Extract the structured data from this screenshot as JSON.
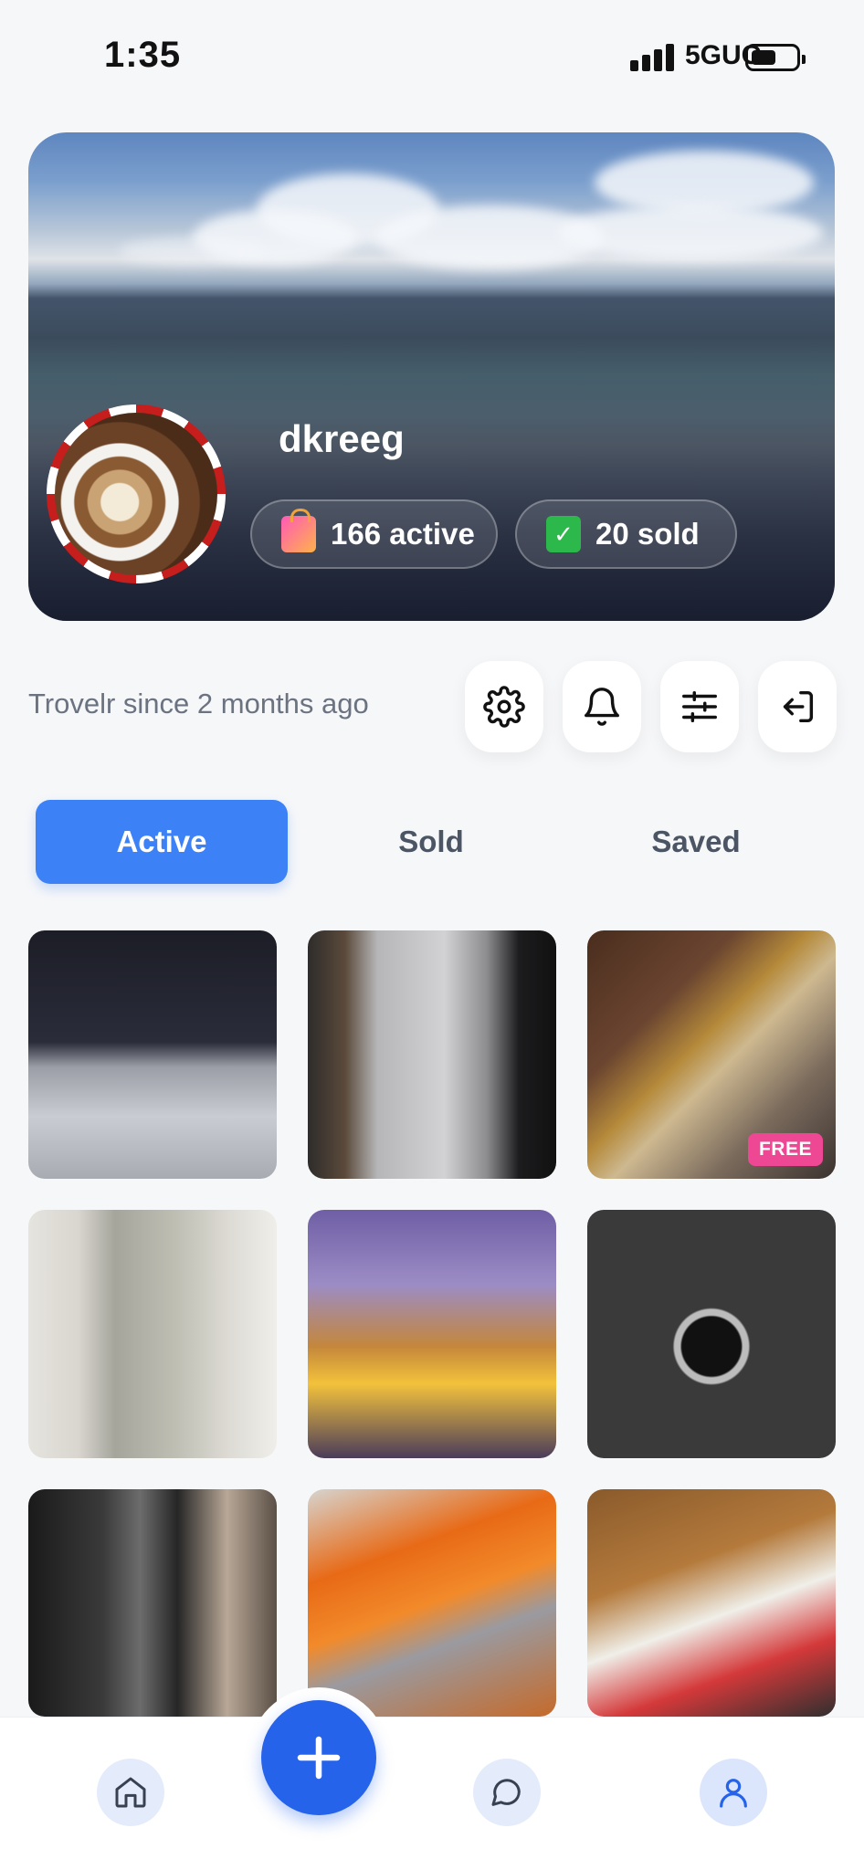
{
  "status_bar": {
    "time": "1:35",
    "network": "5GUC",
    "battery_level": 0.45
  },
  "profile": {
    "username": "dkreeg",
    "active_count_label": "166 active",
    "sold_count_label": "20 sold",
    "member_since": "Trovelr since 2 months ago",
    "avatar": "profile-photo-latte"
  },
  "actions": [
    {
      "name": "settings",
      "icon": "gear-icon"
    },
    {
      "name": "notifications",
      "icon": "bell-icon"
    },
    {
      "name": "filters",
      "icon": "sliders-icon"
    },
    {
      "name": "logout",
      "icon": "logout-icon"
    }
  ],
  "tabs": [
    {
      "label": "Active",
      "selected": true
    },
    {
      "label": "Sold",
      "selected": false
    },
    {
      "label": "Saved",
      "selected": false
    }
  ],
  "listings": [
    {
      "image": "laptop-photo"
    },
    {
      "image": "mac-pro-tower-photo"
    },
    {
      "image": "dyson-vacuum-photo",
      "badge": "FREE"
    },
    {
      "image": "oscilloscope-photo"
    },
    {
      "image": "cheese-thief-game-photo"
    },
    {
      "image": "wristwatch-photo"
    },
    {
      "image": "coffee-grinder-photo"
    },
    {
      "image": "bag-of-parts-photo"
    },
    {
      "image": "trading-cards-photo"
    }
  ],
  "bottom_nav": [
    {
      "name": "home",
      "icon": "home-icon"
    },
    {
      "name": "create",
      "icon": "plus-icon"
    },
    {
      "name": "messages",
      "icon": "chat-icon"
    },
    {
      "name": "profile",
      "icon": "user-icon"
    }
  ],
  "colors": {
    "accent": "#3c82f6",
    "fab": "#2563eb",
    "free_badge": "#ee4793",
    "nav_button_bg": "#e4ebfb"
  }
}
